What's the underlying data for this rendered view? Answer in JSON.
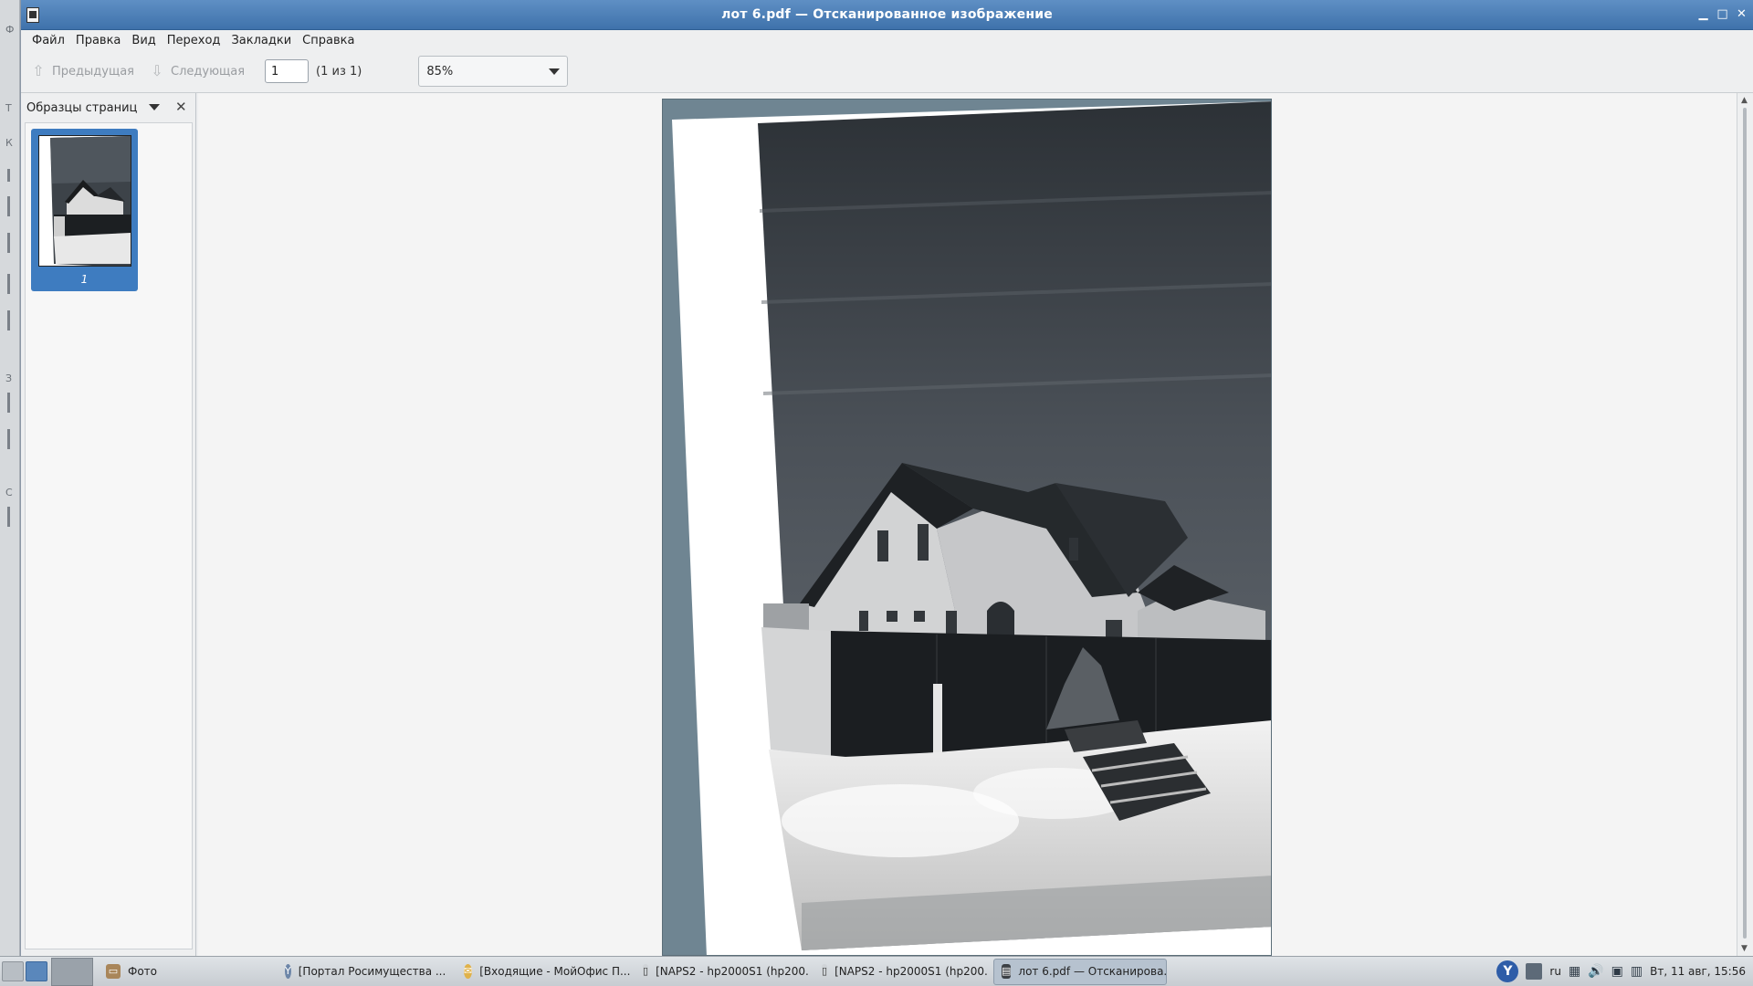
{
  "window": {
    "title": "лот 6.pdf — Отсканированное изображение",
    "controls": [
      "minimize",
      "maximize",
      "close"
    ]
  },
  "menu": {
    "items": [
      {
        "label": "Файл"
      },
      {
        "label": "Правка"
      },
      {
        "label": "Вид"
      },
      {
        "label": "Переход"
      },
      {
        "label": "Закладки"
      },
      {
        "label": "Справка"
      }
    ]
  },
  "toolbar": {
    "prev_label": "Предыдущая",
    "next_label": "Следующая",
    "page_value": "1",
    "page_of": "(1 из 1)",
    "zoom_value": "85%"
  },
  "sidebar": {
    "title": "Образцы страниц",
    "thumbnails": [
      {
        "label": "1"
      }
    ]
  },
  "document": {
    "page_count": 1,
    "current_page": 1
  },
  "taskbar": {
    "tasks": [
      {
        "label": "Фото",
        "icon": "folder-icon",
        "active": false
      },
      {
        "label": "[Портал Росимущества ...",
        "icon": "browser-y-icon",
        "active": false
      },
      {
        "label": "[Входящие - МойОфис П...",
        "icon": "mail-icon",
        "active": false
      },
      {
        "label": "[NAPS2 - hp2000S1 (hp200...",
        "icon": "scanner-icon",
        "active": false
      },
      {
        "label": "[NAPS2 - hp2000S1 (hp200...",
        "icon": "scanner-icon",
        "active": false
      },
      {
        "label": "лот 6.pdf — Отсканирова...",
        "icon": "document-viewer-icon",
        "active": true
      }
    ],
    "tray": {
      "lang": "ru",
      "clock": "Вт, 11 авг, 15:56"
    }
  },
  "colors": {
    "titlebar": "#4a7db6",
    "selection": "#3e7cc0"
  }
}
